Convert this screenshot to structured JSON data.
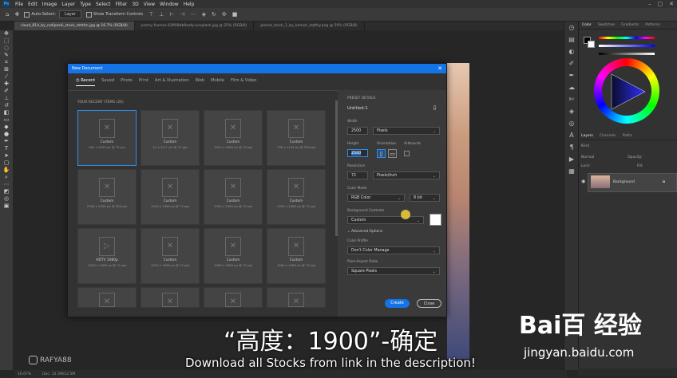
{
  "menubar": {
    "logo": "Ps",
    "items": [
      "File",
      "Edit",
      "Image",
      "Layer",
      "Type",
      "Select",
      "Filter",
      "3D",
      "View",
      "Window",
      "Help"
    ]
  },
  "window_controls": [
    "–",
    "▢",
    "✕"
  ],
  "options_bar": {
    "auto_select": "Auto-Select:",
    "layer_select": "Layer",
    "transform_controls": "Show Transform Controls"
  },
  "document_tabs": [
    "cloud_814_by_rodipeski_stock_dmthn.jpg @ 16.7% (RGB/8)",
    "promy fsomsx 83ff48db9eafy-unsplash.jpg @ 25% (RGB/8)",
    "planet_stock_1_by_kamoh_dqfthy.png @ 50% (RGB/8)"
  ],
  "status": {
    "zoom": "16.67%",
    "doc": "Doc: 12.5M/12.5M"
  },
  "panels": {
    "color_tabs": [
      "Color",
      "Swatches",
      "Gradients",
      "Patterns"
    ],
    "layers_tabs": [
      "Layers",
      "Channels",
      "Paths"
    ],
    "layers_kind": "Kind",
    "layers_mode": "Normal",
    "layers_opacity": "Opacity:",
    "layers_lock": "Lock:",
    "layers_fill": "Fill:",
    "background_layer": "Background",
    "colors": {
      "accent": "#1473e6",
      "fg": "#000000",
      "bg": "#ffffff"
    }
  },
  "dialog": {
    "title": "New Document",
    "tabs": [
      "Recent",
      "Saved",
      "Photo",
      "Print",
      "Art & Illustration",
      "Web",
      "Mobile",
      "Film & Video"
    ],
    "recent_label": "YOUR RECENT ITEMS (20)",
    "tiles": [
      {
        "name": "Custom",
        "size": "900 x 2000 px @ 72 ppi"
      },
      {
        "name": "Custom",
        "size": "21 x 29.7 cm @ 72 ppi"
      },
      {
        "name": "Custom",
        "size": "1920 x 1080 px @ 72 ppi"
      },
      {
        "name": "Custom",
        "size": "736 x 1104 px @ 300 ppi"
      },
      {
        "name": "Custom",
        "size": "2300 x 2300 px @ 300 ppi"
      },
      {
        "name": "Custom",
        "size": "1920 x 1080 px @ 72 ppi"
      },
      {
        "name": "Custom",
        "size": "2300 x 2300 px @ 72 ppi"
      },
      {
        "name": "Custom",
        "size": "1920 x 1080 px @ 72 ppi"
      },
      {
        "name": "HDTV 1080p",
        "size": "1920 x 1080 px @ 72 ppi"
      },
      {
        "name": "Custom",
        "size": "1920 x 1080 px @ 72 ppi"
      },
      {
        "name": "Custom",
        "size": "1080 x 1080 px @ 72 ppi"
      },
      {
        "name": "Custom",
        "size": "1080 x 1080 px @ 72 ppi"
      },
      {
        "name": "",
        "size": ""
      },
      {
        "name": "",
        "size": ""
      },
      {
        "name": "",
        "size": ""
      },
      {
        "name": "",
        "size": ""
      }
    ],
    "preset": {
      "section": "PRESET DETAILS",
      "name": "Untitled-1",
      "width_label": "Width",
      "width": "2500",
      "width_unit": "Pixels",
      "height_label": "Height",
      "height": "2500",
      "orientation_label": "Orientation",
      "artboards_label": "Artboards",
      "resolution_label": "Resolution",
      "resolution": "72",
      "resolution_unit": "Pixels/Inch",
      "color_mode_label": "Color Mode",
      "color_mode": "RGB Color",
      "bit_depth": "8 bit",
      "bg_contents_label": "Background Contents",
      "bg_contents": "Custom",
      "advanced": "Advanced Options",
      "color_profile_label": "Color Profile",
      "color_profile": "Don't Color Manage",
      "pixel_aspect_label": "Pixel Aspect Ratio",
      "pixel_aspect": "Square Pixels"
    },
    "create_label": "Create",
    "close_label": "Close"
  },
  "subtitle_cn": "“高度：1900”-确定",
  "subtitle_en": "Download all Stocks from link in the description!",
  "watermark_insta": "RAFYA88",
  "watermark_baidu": "Bai百 经验",
  "watermark_url": "jingyan.baidu.com"
}
